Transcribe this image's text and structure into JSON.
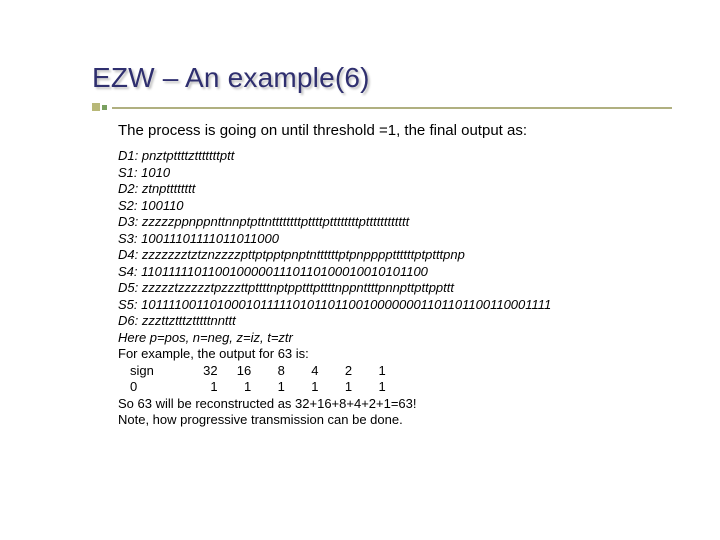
{
  "title": "EZW – An example(6)",
  "subtitle": "The process is going on until threshold =1, the final output as:",
  "lines": {
    "d1": "D1: pnztpttttztttttttptt",
    "s1": "S1: 1010",
    "d2": "D2: ztnptttttttt",
    "s2": "S2: 100110",
    "d3": "D3: zzzzzppnppnttnnptpttnttttttttpttttpttttttttptttttttttttt",
    "s3": "S3: 10011101111011011000",
    "d4": "D4: zzzzzzztztznzzzzpttptpptpnptnttttttptpnppppttttttptptttpnp",
    "s4": "S4: 11011111011001000001110110100010010101100",
    "d5": "D5: zzzzztzzzzztpzzzttpttttnptpptttpttttnppnttttpnnpttpttppttt",
    "s5": "S5: 10111100110100010111110101101100100000001101101100110001111",
    "d6": "D6: zzzttztttztttttnnttt",
    "here": "Here p=pos, n=neg, z=iz, t=ztr"
  },
  "example": {
    "intro": "For example, the output for 63 is:",
    "row_labels": [
      "sign",
      "0"
    ],
    "cols": [
      "32",
      "16",
      "8",
      "4",
      "2",
      "1"
    ],
    "vals": [
      "1",
      "1",
      "1",
      "1",
      "1",
      "1"
    ],
    "recon": "So 63 will be reconstructed as 32+16+8+4+2+1=63!",
    "note": "Note, how progressive transmission can be done."
  }
}
